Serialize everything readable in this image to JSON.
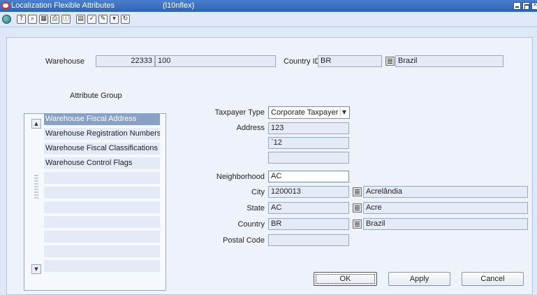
{
  "window": {
    "title": "Localization Flexible Attributes",
    "subtitle": "(l10nflex)"
  },
  "toolbar": {
    "icons": [
      "globe-icon",
      "help-icon",
      "find-icon",
      "calendar-icon",
      "print-icon",
      "info-icon",
      "grid-icon",
      "checkmark-icon",
      "notes-icon",
      "filter-icon",
      "refresh-icon"
    ]
  },
  "header": {
    "warehouse_label": "Warehouse",
    "warehouse_id": "22333",
    "warehouse_name": "100",
    "country_label": "Country ID",
    "country_id": "BR",
    "country_name": "Brazil"
  },
  "attribute_group": {
    "title": "Attribute Group",
    "items": [
      "Warehouse Fiscal Address",
      "Warehouse Registration Numbers",
      "Warehouse Fiscal Classifications",
      "Warehouse Control Flags",
      "",
      "",
      "",
      "",
      "",
      "",
      ""
    ],
    "selected_index": 0
  },
  "form": {
    "taxpayer_type_label": "Taxpayer Type",
    "taxpayer_type_value": "Corporate Taxpayer",
    "address_label": "Address",
    "address_line1": "123",
    "address_line2": "`12",
    "address_line3": "",
    "neighborhood_label": "Neighborhood",
    "neighborhood_value": "AC",
    "city_label": "City",
    "city_code": "1200013",
    "city_name": "Acrelândia",
    "state_label": "State",
    "state_code": "AC",
    "state_name": "Acre",
    "country_label": "Country",
    "country_code": "BR",
    "country_name": "Brazil",
    "postal_code_label": "Postal Code",
    "postal_code_value": ""
  },
  "buttons": {
    "ok": "OK",
    "apply": "Apply",
    "cancel": "Cancel"
  },
  "colors": {
    "titlebar": "#3a6fc2",
    "panel": "#eef2fa",
    "selected_row": "#8aa1c6"
  }
}
